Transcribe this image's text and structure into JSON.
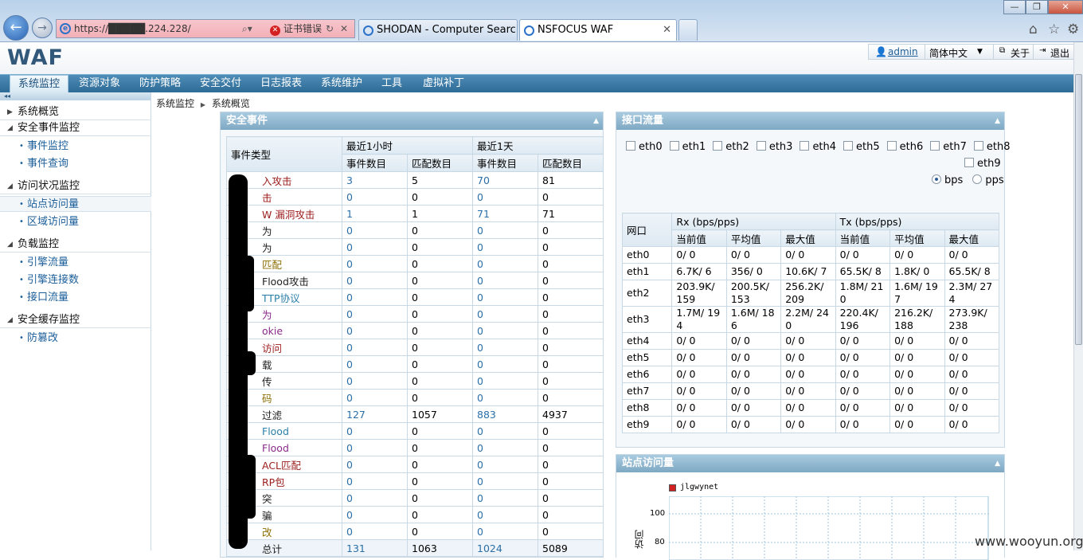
{
  "browser": {
    "url": "https://█████.224.228/",
    "cert_error": "证书错误",
    "tabs": [
      {
        "title": "SHODAN - Computer Searc..."
      },
      {
        "title": "NSFOCUS WAF"
      }
    ],
    "window_controls": [
      "—",
      "❐",
      "✕"
    ]
  },
  "header": {
    "logo": "WAF",
    "user": "admin",
    "language": "简体中文",
    "about": "关于",
    "logout": "退出"
  },
  "menu": [
    "系统监控",
    "资源对象",
    "防护策略",
    "安全交付",
    "日志报表",
    "系统维护",
    "工具",
    "虚拟补丁"
  ],
  "breadcrumb": {
    "root": "系统监控",
    "current": "系统概览"
  },
  "sidebar": {
    "groups": [
      {
        "label": "系统概览",
        "items": []
      },
      {
        "label": "安全事件监控",
        "items": [
          "事件监控",
          "事件查询"
        ]
      },
      {
        "label": "访问状况监控",
        "items": [
          "站点访问量",
          "区域访问量"
        ]
      },
      {
        "label": "负载监控",
        "items": [
          "引擎流量",
          "引擎连接数",
          "接口流量"
        ]
      },
      {
        "label": "安全缓存监控",
        "items": [
          "防篡改"
        ]
      }
    ]
  },
  "security_events": {
    "title": "安全事件",
    "headers": {
      "type": "事件类型",
      "last_hour": "最近1小时",
      "last_day": "最近1天",
      "event_count": "事件数目",
      "match_count": "匹配数目"
    },
    "rows": [
      {
        "type": "入攻击",
        "c1": "3",
        "m1": "5",
        "c2": "70",
        "m2": "81",
        "color": "#9c1c1c"
      },
      {
        "type": "击",
        "c1": "0",
        "m1": "0",
        "c2": "0",
        "m2": "0",
        "color": "#9c1c1c"
      },
      {
        "type": "W 漏洞攻击",
        "c1": "1",
        "m1": "1",
        "c2": "71",
        "m2": "71",
        "color": "#9c1c1c"
      },
      {
        "type": "为",
        "c1": "0",
        "m1": "0",
        "c2": "0",
        "m2": "0",
        "color": "#222"
      },
      {
        "type": "为",
        "c1": "0",
        "m1": "0",
        "c2": "0",
        "m2": "0",
        "color": "#222"
      },
      {
        "type": "匹配",
        "c1": "0",
        "m1": "0",
        "c2": "0",
        "m2": "0",
        "color": "#8a6d00"
      },
      {
        "type": "Flood攻击",
        "c1": "0",
        "m1": "0",
        "c2": "0",
        "m2": "0",
        "color": "#222"
      },
      {
        "type": "TTP协议",
        "c1": "0",
        "m1": "0",
        "c2": "0",
        "m2": "0",
        "color": "#2a7fa8"
      },
      {
        "type": "为",
        "c1": "0",
        "m1": "0",
        "c2": "0",
        "m2": "0",
        "color": "#8a2a8a"
      },
      {
        "type": "okie",
        "c1": "0",
        "m1": "0",
        "c2": "0",
        "m2": "0",
        "color": "#8a2a8a"
      },
      {
        "type": "访问",
        "c1": "0",
        "m1": "0",
        "c2": "0",
        "m2": "0",
        "color": "#9c1c1c"
      },
      {
        "type": "载",
        "c1": "0",
        "m1": "0",
        "c2": "0",
        "m2": "0",
        "color": "#222"
      },
      {
        "type": "传",
        "c1": "0",
        "m1": "0",
        "c2": "0",
        "m2": "0",
        "color": "#222"
      },
      {
        "type": "码",
        "c1": "0",
        "m1": "0",
        "c2": "0",
        "m2": "0",
        "color": "#8a6d00"
      },
      {
        "type": "过滤",
        "c1": "127",
        "m1": "1057",
        "c2": "883",
        "m2": "4937",
        "color": "#222"
      },
      {
        "type": "Flood",
        "c1": "0",
        "m1": "0",
        "c2": "0",
        "m2": "0",
        "color": "#2a7fa8"
      },
      {
        "type": "Flood",
        "c1": "0",
        "m1": "0",
        "c2": "0",
        "m2": "0",
        "color": "#8a2a8a"
      },
      {
        "type": "ACL匹配",
        "c1": "0",
        "m1": "0",
        "c2": "0",
        "m2": "0",
        "color": "#9c1c1c"
      },
      {
        "type": "RP包",
        "c1": "0",
        "m1": "0",
        "c2": "0",
        "m2": "0",
        "color": "#9c1c1c"
      },
      {
        "type": "突",
        "c1": "0",
        "m1": "0",
        "c2": "0",
        "m2": "0",
        "color": "#222"
      },
      {
        "type": "骗",
        "c1": "0",
        "m1": "0",
        "c2": "0",
        "m2": "0",
        "color": "#222"
      },
      {
        "type": "改",
        "c1": "0",
        "m1": "0",
        "c2": "0",
        "m2": "0",
        "color": "#8a6d00"
      },
      {
        "type": "总计",
        "c1": "131",
        "m1": "1063",
        "c2": "1024",
        "m2": "5089",
        "color": "#222"
      }
    ]
  },
  "interface_traffic": {
    "title": "接口流量",
    "checkboxes": [
      "eth0",
      "eth1",
      "eth2",
      "eth3",
      "eth4",
      "eth5",
      "eth6",
      "eth7",
      "eth8",
      "eth9"
    ],
    "unit_options": [
      "bps",
      "pps"
    ],
    "unit_selected": "bps",
    "headers": {
      "port": "网口",
      "rx": "Rx (bps/pps)",
      "tx": "Tx (bps/pps)",
      "current": "当前值",
      "average": "平均值",
      "max": "最大值"
    },
    "rows": [
      {
        "port": "eth0",
        "rx_cur": "0/ 0",
        "rx_avg": "0/ 0",
        "rx_max": "0/ 0",
        "tx_cur": "0/ 0",
        "tx_avg": "0/ 0",
        "tx_max": "0/ 0"
      },
      {
        "port": "eth1",
        "rx_cur": "6.7K/ 6",
        "rx_avg": "356/ 0",
        "rx_max": "10.6K/ 7",
        "tx_cur": "65.5K/ 8",
        "tx_avg": "1.8K/ 0",
        "tx_max": "65.5K/ 8"
      },
      {
        "port": "eth2",
        "rx_cur": "203.9K/ 159",
        "rx_avg": "200.5K/ 153",
        "rx_max": "256.2K/ 209",
        "tx_cur": "1.8M/ 210",
        "tx_avg": "1.6M/ 197",
        "tx_max": "2.3M/ 274"
      },
      {
        "port": "eth3",
        "rx_cur": "1.7M/ 194",
        "rx_avg": "1.6M/ 186",
        "rx_max": "2.2M/ 240",
        "tx_cur": "220.4K/ 196",
        "tx_avg": "216.2K/ 188",
        "tx_max": "273.9K/ 238"
      },
      {
        "port": "eth4",
        "rx_cur": "0/ 0",
        "rx_avg": "0/ 0",
        "rx_max": "0/ 0",
        "tx_cur": "0/ 0",
        "tx_avg": "0/ 0",
        "tx_max": "0/ 0"
      },
      {
        "port": "eth5",
        "rx_cur": "0/ 0",
        "rx_avg": "0/ 0",
        "rx_max": "0/ 0",
        "tx_cur": "0/ 0",
        "tx_avg": "0/ 0",
        "tx_max": "0/ 0"
      },
      {
        "port": "eth6",
        "rx_cur": "0/ 0",
        "rx_avg": "0/ 0",
        "rx_max": "0/ 0",
        "tx_cur": "0/ 0",
        "tx_avg": "0/ 0",
        "tx_max": "0/ 0"
      },
      {
        "port": "eth7",
        "rx_cur": "0/ 0",
        "rx_avg": "0/ 0",
        "rx_max": "0/ 0",
        "tx_cur": "0/ 0",
        "tx_avg": "0/ 0",
        "tx_max": "0/ 0"
      },
      {
        "port": "eth8",
        "rx_cur": "0/ 0",
        "rx_avg": "0/ 0",
        "rx_max": "0/ 0",
        "tx_cur": "0/ 0",
        "tx_avg": "0/ 0",
        "tx_max": "0/ 0"
      },
      {
        "port": "eth9",
        "rx_cur": "0/ 0",
        "rx_avg": "0/ 0",
        "rx_max": "0/ 0",
        "tx_cur": "0/ 0",
        "tx_avg": "0/ 0",
        "tx_max": "0/ 0"
      }
    ]
  },
  "site_visits": {
    "title": "站点访问量",
    "legend": "jlgwynet",
    "legend_color": "#d32020",
    "y_ticks": [
      "100",
      "80"
    ],
    "y_label": "访问"
  },
  "watermark": "www.wooyun.org"
}
